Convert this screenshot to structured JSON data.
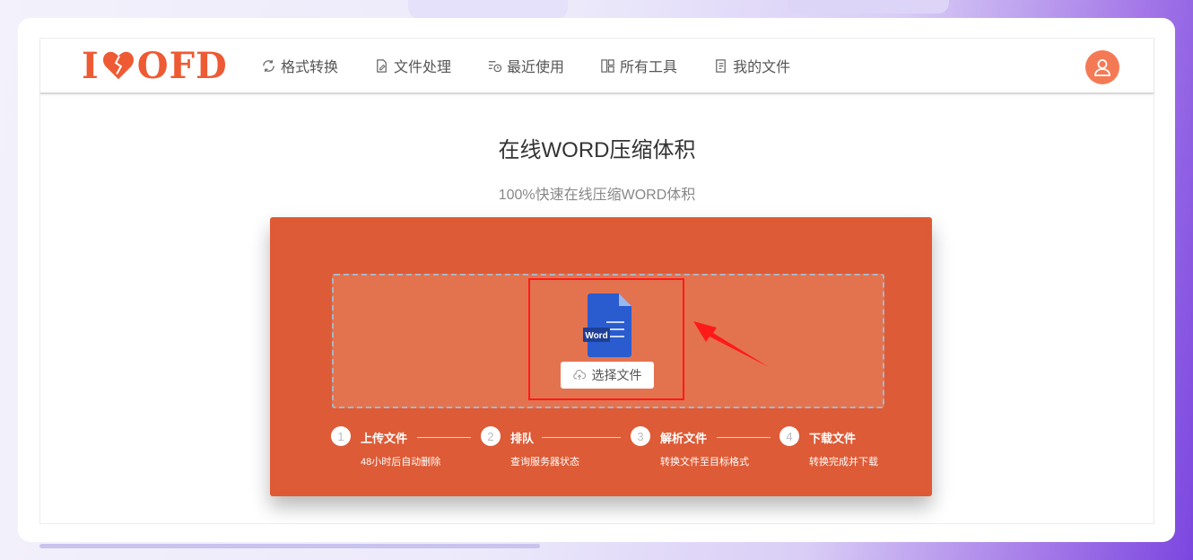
{
  "brand": {
    "logo_prefix": "I",
    "logo_suffix": "OFD",
    "accent_color": "#ee5a33"
  },
  "nav": {
    "items": [
      {
        "label": "格式转换",
        "icon": "convert-icon"
      },
      {
        "label": "文件处理",
        "icon": "file-edit-icon"
      },
      {
        "label": "最近使用",
        "icon": "recent-icon"
      },
      {
        "label": "所有工具",
        "icon": "grid-icon"
      },
      {
        "label": "我的文件",
        "icon": "my-files-icon"
      }
    ],
    "avatar_icon": "user-icon"
  },
  "main": {
    "title": "在线WORD压缩体积",
    "subtitle": "100%快速在线压缩WORD体积"
  },
  "upload": {
    "file_icon_label": "Word",
    "button_label": "选择文件",
    "button_icon": "cloud-upload-icon",
    "panel_color": "#de5a34"
  },
  "steps": [
    {
      "number": "1",
      "label": "上传文件",
      "desc": "48小时后自动删除"
    },
    {
      "number": "2",
      "label": "排队",
      "desc": "查询服务器状态"
    },
    {
      "number": "3",
      "label": "解析文件",
      "desc": "转换文件至目标格式"
    },
    {
      "number": "4",
      "label": "下载文件",
      "desc": "转换完成并下载"
    }
  ]
}
